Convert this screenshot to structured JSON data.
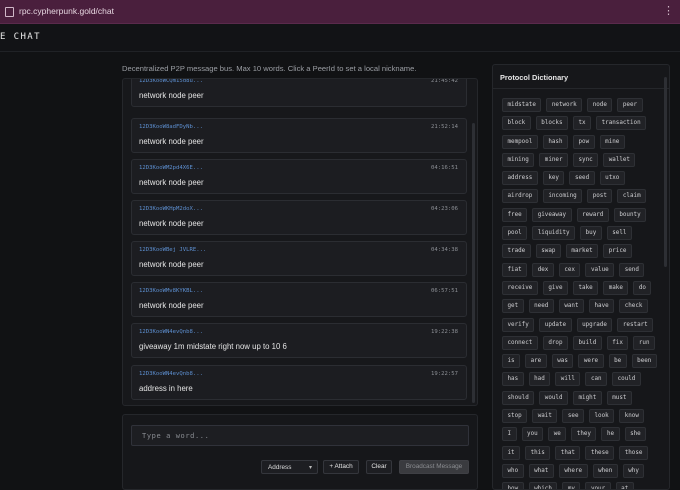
{
  "browser": {
    "url": "rpc.cypherpunk.gold/chat",
    "menu_glyph": "⋮"
  },
  "header": {
    "brand": "E CHAT"
  },
  "intro": "Decentralized P2P message bus. Max 10 words. Click a PeerId to set a local nickname.",
  "messages": [
    {
      "peer": "12D3KooWCQm15d8u...",
      "time": "21:45:42",
      "text": "network node peer"
    },
    {
      "peer": "12D3KooW8adFDyNb...",
      "time": "21:52:14",
      "text": "network node peer"
    },
    {
      "peer": "12D3KooWM2pd4X6E...",
      "time": "04:16:51",
      "text": "network node peer"
    },
    {
      "peer": "12D3KooWKHpM2doX...",
      "time": "04:23:06",
      "text": "network node peer"
    },
    {
      "peer": "12D3KooWBej JVLRE...",
      "time": "04:34:38",
      "text": "network node peer"
    },
    {
      "peer": "12D3KooWMv8KYKBL...",
      "time": "06:57:51",
      "text": "network node peer"
    },
    {
      "peer": "12D3KooWN4evQnb8...",
      "time": "19:22:38",
      "text": "giveaway 1m midstate right now up to 10 6"
    },
    {
      "peer": "12D3KooWN4evQnb8...",
      "time": "19:22:57",
      "text": "address in here"
    }
  ],
  "compose": {
    "placeholder": "Type a word...",
    "address_label": "Address",
    "select_chevron": "▾",
    "attach_label": "+ Attach",
    "clear_label": "Clear",
    "broadcast_label": "Broadcast Message"
  },
  "dictionary": {
    "title": "Protocol Dictionary",
    "words": [
      "midstate",
      "network",
      "node",
      "peer",
      "block",
      "blocks",
      "tx",
      "transaction",
      "mempool",
      "hash",
      "pow",
      "mine",
      "mining",
      "miner",
      "sync",
      "wallet",
      "address",
      "key",
      "seed",
      "utxo",
      "airdrop",
      "incoming",
      "post",
      "claim",
      "free",
      "giveaway",
      "reward",
      "bounty",
      "pool",
      "liquidity",
      "buy",
      "sell",
      "trade",
      "swap",
      "market",
      "price",
      "fiat",
      "dex",
      "cex",
      "value",
      "send",
      "receive",
      "give",
      "take",
      "make",
      "do",
      "get",
      "need",
      "want",
      "have",
      "check",
      "verify",
      "update",
      "upgrade",
      "restart",
      "connect",
      "drop",
      "build",
      "fix",
      "run",
      "is",
      "are",
      "was",
      "were",
      "be",
      "been",
      "has",
      "had",
      "will",
      "can",
      "could",
      "should",
      "would",
      "might",
      "must",
      "stop",
      "wait",
      "see",
      "look",
      "know",
      "I",
      "you",
      "we",
      "they",
      "he",
      "she",
      "it",
      "this",
      "that",
      "these",
      "those",
      "who",
      "what",
      "where",
      "when",
      "why",
      "how",
      "which",
      "my",
      "your",
      "at"
    ]
  }
}
